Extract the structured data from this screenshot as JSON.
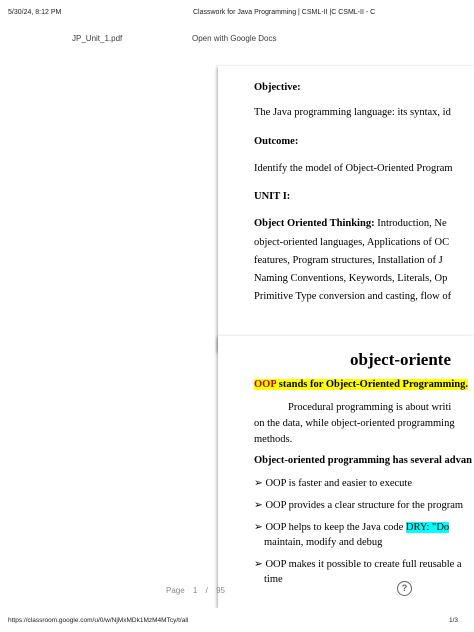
{
  "print_header": {
    "date": "5/30/24, 8:12 PM",
    "title": "Classwork for Java Programming | CSML-II |C CSML-II - C"
  },
  "toolbar": {
    "filename": "JP_Unit_1.pdf",
    "open_with": "Open with Google Docs"
  },
  "page1": {
    "objective_label": "Objective:",
    "objective_text": "The Java programming language: its syntax, id",
    "outcome_label": "Outcome:",
    "outcome_text": "Identify the model of Object-Oriented Program",
    "unit_label": "UNIT I:",
    "unit_heading": "Object Oriented Thinking:",
    "unit_line1": " Introduction, Ne",
    "unit_line2": "object-oriented languages, Applications of OC",
    "unit_line3": "features, Program structures, Installation of J",
    "unit_line4": "Naming Conventions, Keywords, Literals, Op",
    "unit_line5": "Primitive Type conversion and casting, flow of"
  },
  "page2": {
    "heading": "object-oriente",
    "oop_abbr": "OOP",
    "oop_rest": " stands for Object-Oriented Programming.",
    "para_line1": "Procedural programming is about writi",
    "para_line2": "on the data, while object-oriented programming",
    "para_line3": "methods.",
    "advantages_heading": "Object-oriented programming has several advan",
    "bullet1": "OOP is faster and easier to execute",
    "bullet2": "OOP provides a clear structure for the program",
    "bullet3_pre": "OOP helps to keep the Java code ",
    "bullet3_hl": "DRY: \"Do",
    "bullet3_line2": "maintain, modify and debug",
    "bullet4": "OOP makes it possible to create full reusable a",
    "bullet4_line2": "time",
    "bullet_glyph": "➢"
  },
  "pager": {
    "label": "Page",
    "current": "1",
    "separator": "/",
    "total": "95"
  },
  "help": {
    "glyph": "?"
  },
  "print_footer": {
    "url": "https://classroom.google.com/u/0/w/NjMxMDk1MzM4MTcy/t/all",
    "page": "1/3"
  }
}
